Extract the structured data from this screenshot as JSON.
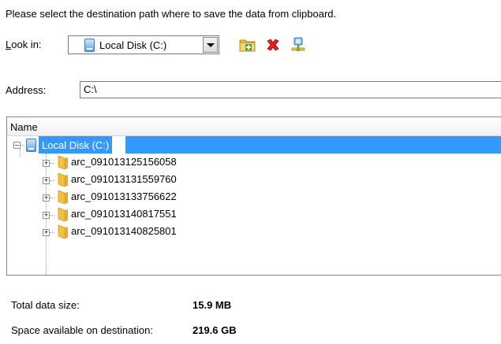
{
  "instruction": "Please select the destination path where to save the data from clipboard.",
  "look_in": {
    "label_underlined": "L",
    "label_rest": "ook in:",
    "selected": "Local Disk (C:)"
  },
  "toolbar": {
    "new_folder_icon": "new-folder-icon",
    "delete_icon": "delete-icon",
    "network_drive_icon": "network-drive-icon"
  },
  "address": {
    "label": "Address:",
    "value": "C:\\"
  },
  "tree": {
    "column_header": "Name",
    "root": "Local Disk (C:)",
    "items": [
      "arc_091013125156058",
      "arc_091013131559760",
      "arc_091013133756622",
      "arc_091013140817551",
      "arc_091013140825801"
    ]
  },
  "summary": {
    "total_label": "Total data size:",
    "total_value": "15.9 MB",
    "space_label": "Space available on destination:",
    "space_value": "219.6 GB"
  },
  "colors": {
    "selection": "#3399ff",
    "folder": "#f2c144",
    "delete": "#e02020"
  }
}
